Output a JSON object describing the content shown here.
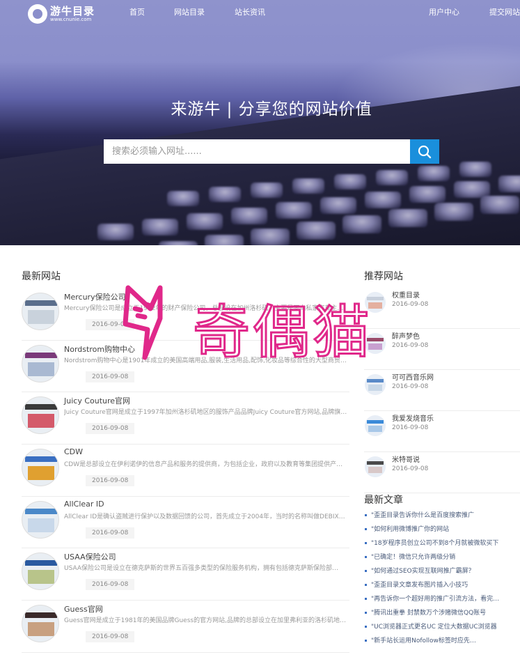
{
  "logo": {
    "name": "游牛目录",
    "url": "www.cnunie.com"
  },
  "nav": {
    "items": [
      "首页",
      "网站目录",
      "站长资讯"
    ],
    "user_center": "用户中心",
    "submit_site": "提交网站"
  },
  "hero": {
    "title": "来游牛 | 分享您的网站价值",
    "search_placeholder": "搜索必须输入网址......"
  },
  "latest_sites": {
    "title": "最新网站",
    "items": [
      {
        "name": "Mercury保险公司",
        "desc": "Mercury保险公司是成立于1962年的财产保险公司，总部设在加州洛杉矶，主要是面向私家汽车主…",
        "date": "2016-09-08"
      },
      {
        "name": "Nordstrom购物中心",
        "desc": "Nordstrom购物中心是1901年成立的美国高端用品,服装,生活用品,配饰,化妆品等综合性的大型商贸…",
        "date": "2016-09-08"
      },
      {
        "name": "Juicy Couture官网",
        "desc": "Juicy Couture官网是成立于1997年加州洛杉矶地区的服饰产品品牌Juicy Couture官方网站,品牌旗下…",
        "date": "2016-09-08"
      },
      {
        "name": "CDW",
        "desc": "CDW是总部设立在伊利诺伊的信息产品和服务的提供商，为包括企业，政府以及教育等集团提供产…",
        "date": "2016-09-08"
      },
      {
        "name": "AllClear ID",
        "desc": "AllClear ID是确认盗贼进行保护以及数据回馈的公司，首先成立于2004年，当时的名称叫做DEBIX…",
        "date": "2016-09-08"
      },
      {
        "name": "USAA保险公司",
        "desc": "USAA保险公司是设立在德克萨斯的世界五百强多类型的保险服务机构，拥有包括德克萨斯保险部…",
        "date": "2016-09-08"
      },
      {
        "name": "Guess官网",
        "desc": "Guess官网是成立于1981年的美国品牌Guess的官方网站,品牌的总部设立在加里弗利亚的洛杉矶地…",
        "date": "2016-09-08"
      }
    ]
  },
  "recommended": {
    "title": "推荐网站",
    "items": [
      {
        "name": "权重目录",
        "date": "2016-09-08"
      },
      {
        "name": "醉声梦色",
        "date": "2016-09-08"
      },
      {
        "name": "可可西音乐网",
        "date": "2016-09-08"
      },
      {
        "name": "我爱发烧音乐",
        "date": "2016-09-08"
      },
      {
        "name": "米特哥说",
        "date": "2016-09-08"
      }
    ]
  },
  "articles": {
    "title": "最新文章",
    "items": [
      "\"歪歪目录告诉你什么是百度搜索推广",
      "\"如何利用微博推广你的网站",
      "\"18岁程序员创立公司不到8个月就被微软买下",
      "\"已确定！微信只允许两级分销",
      "\"如何通过SEO实现互联网推广霸屏？",
      "\"歪歪目录文章发布图片插入小技巧",
      "\"再告诉你一个超好用的推广引流方法，看完…",
      "\"腾讯出重拳 封禁数万个涉赌微信QQ账号",
      "\"UC浏览器正式更名UC 定位大数据UC浏览器",
      "\"新手站长运用Nofollow标签时应先…"
    ]
  },
  "watermark": {
    "text": "奇偶猫"
  },
  "colors": {
    "search_button": "#1a8fdc",
    "watermark": "#e0288a",
    "hero_top": "#8b8fcb"
  }
}
